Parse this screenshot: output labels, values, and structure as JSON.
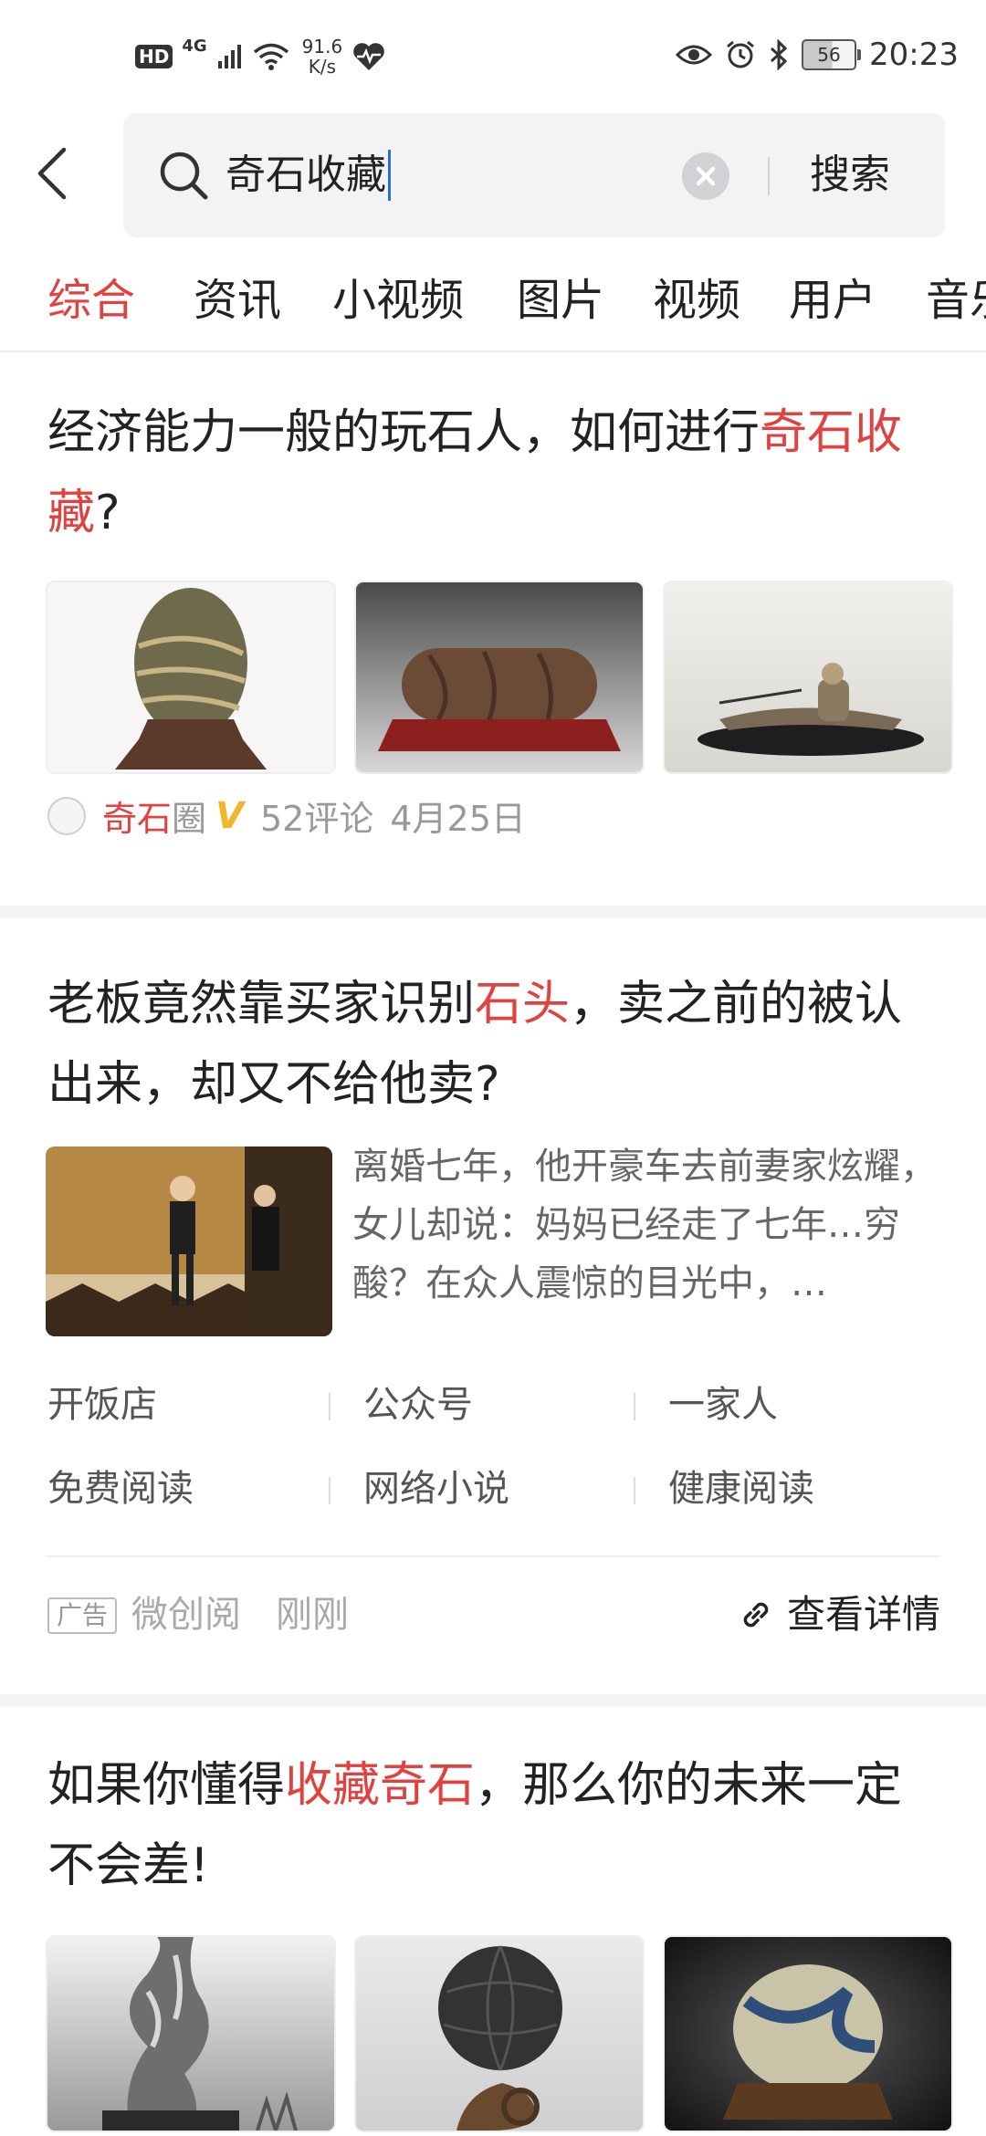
{
  "status_bar": {
    "hd": "HD",
    "network": "4G",
    "speed_value": "91.6",
    "speed_unit": "K/s",
    "battery": "56",
    "time": "20:23"
  },
  "search": {
    "query": "奇石收藏",
    "button_label": "搜索"
  },
  "tabs": [
    "综合",
    "资讯",
    "小视频",
    "图片",
    "视频",
    "用户",
    "音乐"
  ],
  "articles": [
    {
      "title_prefix": "经济能力一般的玩石人，如何进行",
      "title_highlight": "奇石收藏",
      "title_suffix": "?",
      "source_highlight": "奇石",
      "source_rest": "圈",
      "verified_mark": "V",
      "comments": "52评论",
      "date": "4月25日"
    },
    {
      "title_prefix": "老板竟然靠买家识别",
      "title_highlight": "石头",
      "title_suffix": "，卖之前的被认出来，却又不给他卖?",
      "description": "离婚七年，他开豪车去前妻家炫耀，女儿却说：妈妈已经走了七年…穷酸？在众人震惊的目光中，…",
      "keywords": [
        "开饭店",
        "公众号",
        "一家人",
        "免费阅读",
        "网络小说",
        "健康阅读"
      ],
      "ad_badge": "广告",
      "advertiser": "微创阅",
      "time": "刚刚",
      "detail_label": "查看详情"
    },
    {
      "title_prefix": "如果你懂得",
      "title_highlight": "收藏奇石",
      "title_suffix": "，那么你的未来一定不会差!"
    }
  ],
  "colors": {
    "accent": "#e2423f",
    "verified": "#f2b62b",
    "cursor": "#2a6fd6"
  }
}
